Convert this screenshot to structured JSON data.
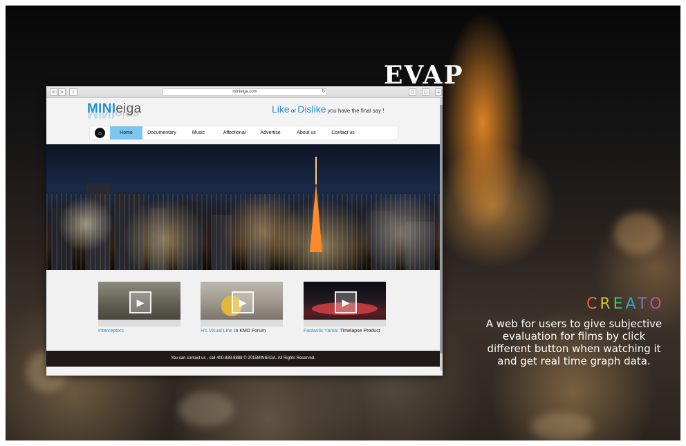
{
  "showcase": {
    "project_title": "EVAP",
    "brand_name": "CREATO",
    "description": "A web for users to give subjective evaluation for films by click different button when watching it and get real time graph data."
  },
  "browser": {
    "url": "minieiga.com",
    "back_label": "<",
    "forward_label": ">"
  },
  "site": {
    "logo": {
      "part1": "MINI",
      "part2": "eiga"
    },
    "tagline": {
      "like": "Like",
      "or": "or",
      "dislike": "Dislike",
      "rest": "you have the final say !"
    },
    "nav": {
      "items": [
        {
          "label": "Home",
          "active": true
        },
        {
          "label": "Documentary"
        },
        {
          "label": "Music"
        },
        {
          "label": "Affectional"
        },
        {
          "label": "Advertise"
        },
        {
          "label": "About us"
        },
        {
          "label": "Contact us"
        }
      ]
    },
    "videos": [
      {
        "title": "Interceptors",
        "extra": ""
      },
      {
        "title": "H's Visual Line",
        "extra": "in KMD Forum"
      },
      {
        "title": "Fantastic Yantai",
        "extra": "Timelapse Product"
      }
    ],
    "footer": "You can contact us , call 400-888-8888 © 2015MINIEIGA. All Rights Reserved."
  },
  "colors": {
    "accent_blue": "#1f8fd6",
    "nav_active": "#7cc6ef",
    "footer_bg": "#1f1a17"
  }
}
